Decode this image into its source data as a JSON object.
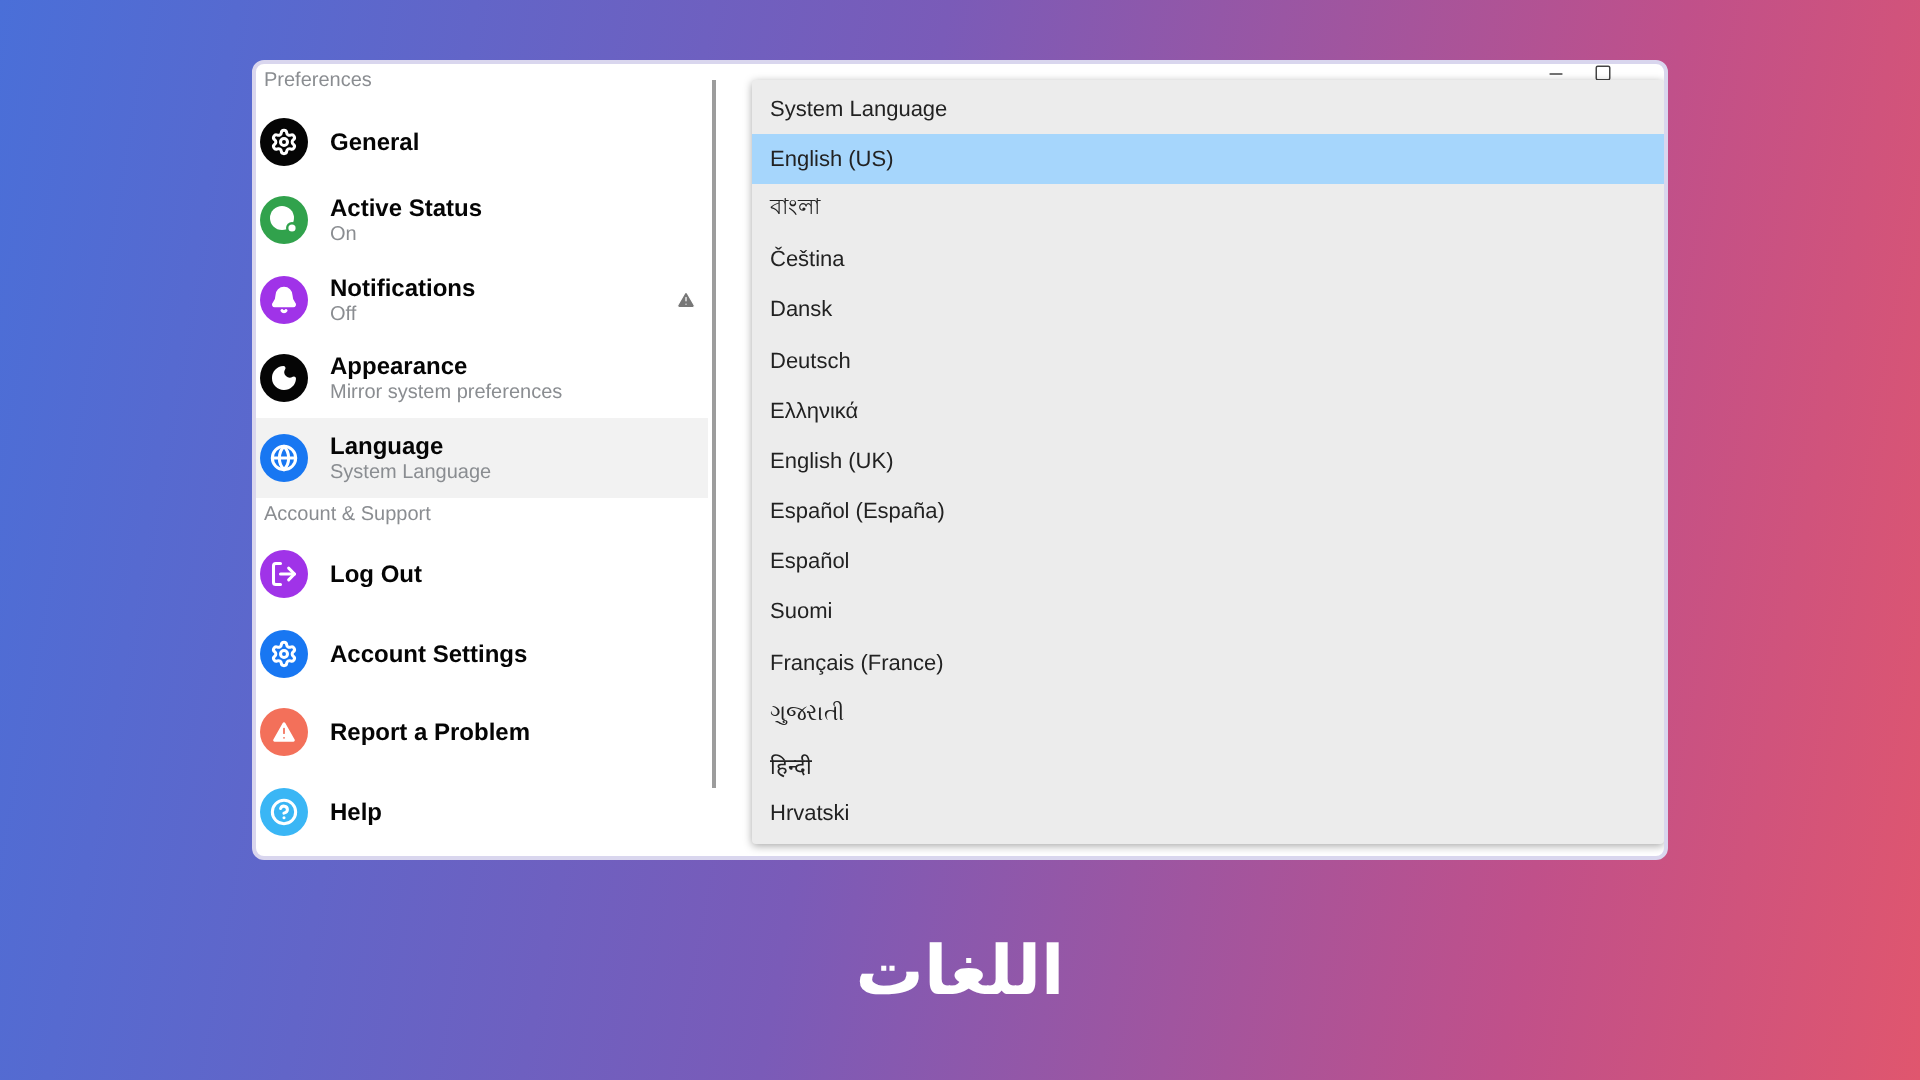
{
  "sidebar": {
    "sections": [
      {
        "title": "Preferences",
        "items": [
          {
            "kind": "gear",
            "color": "#050505",
            "label": "General",
            "selected": false,
            "warning": false
          },
          {
            "kind": "status",
            "color": "#31a24c",
            "label": "Active Status",
            "subtitle": "On",
            "selected": false,
            "warning": false
          },
          {
            "kind": "bell",
            "color": "#a033e8",
            "label": "Notifications",
            "subtitle": "Off",
            "selected": false,
            "warning": true
          },
          {
            "kind": "moon",
            "color": "#050505",
            "label": "Appearance",
            "subtitle": "Mirror system preferences",
            "selected": false,
            "warning": false
          },
          {
            "kind": "globe",
            "color": "#1877f2",
            "label": "Language",
            "subtitle": "System Language",
            "selected": true,
            "warning": false
          }
        ]
      },
      {
        "title": "Account & Support",
        "items": [
          {
            "kind": "logout",
            "color": "#a033e8",
            "label": "Log Out",
            "selected": false,
            "warning": false
          },
          {
            "kind": "gear",
            "color": "#1877f2",
            "label": "Account Settings",
            "selected": false,
            "warning": false
          },
          {
            "kind": "alert",
            "color": "#f3705a",
            "label": "Report a Problem",
            "selected": false,
            "warning": false
          },
          {
            "kind": "help",
            "color": "#3ab6f5",
            "label": "Help",
            "selected": false,
            "warning": false
          }
        ]
      }
    ]
  },
  "language_menu": {
    "options": [
      {
        "label": "System Language",
        "selected": false
      },
      {
        "label": "English (US)",
        "selected": true
      },
      {
        "label": "বাংলা",
        "selected": false
      },
      {
        "label": "Čeština",
        "selected": false
      },
      {
        "label": "Dansk",
        "selected": false
      },
      {
        "label": "Deutsch",
        "selected": false
      },
      {
        "label": "Ελληνικά",
        "selected": false
      },
      {
        "label": "English (UK)",
        "selected": false
      },
      {
        "label": "Español (España)",
        "selected": false
      },
      {
        "label": "Español",
        "selected": false
      },
      {
        "label": "Suomi",
        "selected": false
      },
      {
        "label": "Français (France)",
        "selected": false
      },
      {
        "label": "ગુજરાતી",
        "selected": false
      },
      {
        "label": "हिन्दी",
        "selected": false
      },
      {
        "label": "Hrvatski",
        "selected": false
      }
    ]
  },
  "caption": "اللغات"
}
